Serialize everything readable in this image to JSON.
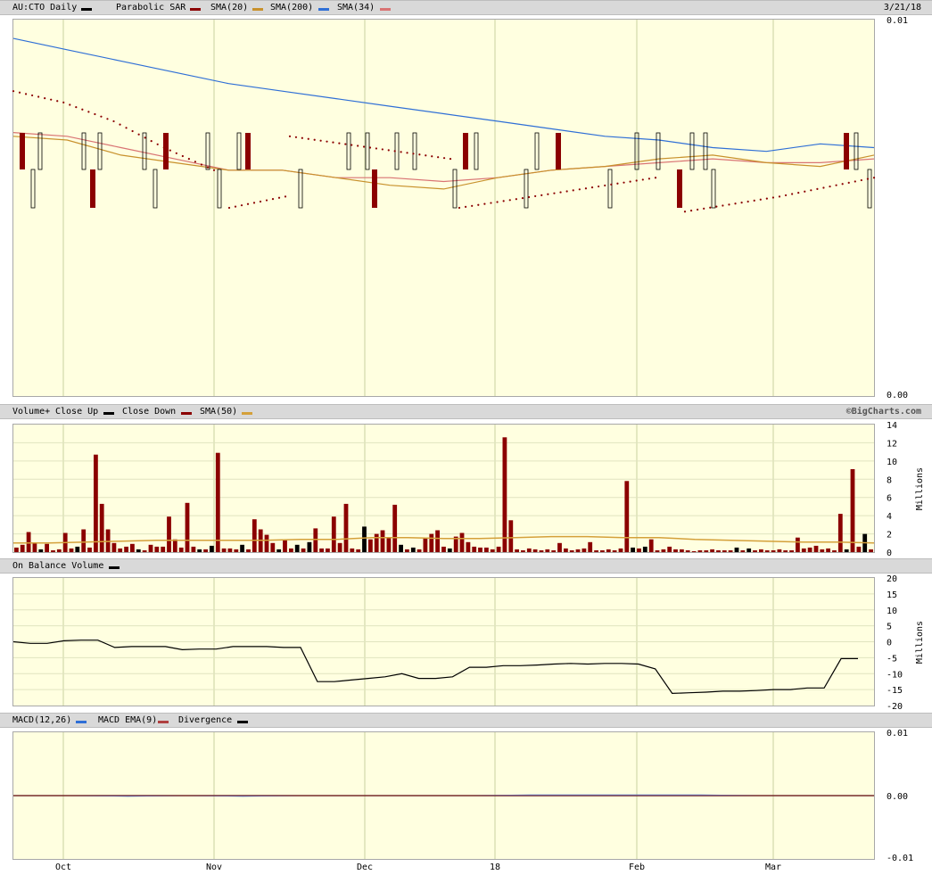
{
  "header": {
    "symbol_label": "AU:CTO Daily",
    "indicators": [
      {
        "label": "Parabolic SAR",
        "color": "#8b0000"
      },
      {
        "label": "SMA(20)",
        "color": "#c8912c"
      },
      {
        "label": "SMA(200)",
        "color": "#2f6fd6"
      },
      {
        "label": "SMA(34)",
        "color": "#d97373"
      }
    ],
    "symbol_color": "#000000",
    "date": "3/21/18"
  },
  "volume_header": {
    "label": "Volume+",
    "items": [
      {
        "label": "Close Up",
        "color": "#000000"
      },
      {
        "label": "Close Down",
        "color": "#8b0000"
      },
      {
        "label": "SMA(50)",
        "color": "#d4a03a"
      }
    ],
    "credit": "©BigCharts.com"
  },
  "obv_header": {
    "label": "On Balance Volume",
    "color": "#000000"
  },
  "macd_header": {
    "items": [
      {
        "label": "MACD(12,26)",
        "color": "#2f6fd6"
      },
      {
        "label": "MACD EMA(9)",
        "color": "#b04040"
      },
      {
        "label": "Divergence",
        "color": "#000000"
      }
    ]
  },
  "x_axis": {
    "labels": [
      "Oct",
      "Nov",
      "Dec",
      "18",
      "Feb",
      "Mar"
    ]
  },
  "chart_data": [
    {
      "type": "line",
      "title": "AU:CTO Daily",
      "ylim": [
        0.0,
        0.01
      ],
      "ytick_labels": [
        "0.01",
        "0.00"
      ],
      "grid": true,
      "series": [
        {
          "name": "SMA(200)",
          "values": [
            0.0095,
            0.0092,
            0.0089,
            0.0086,
            0.0083,
            0.0081,
            0.0079,
            0.0077,
            0.0075,
            0.0073,
            0.0071,
            0.0069,
            0.0068,
            0.0066,
            0.0065,
            0.0067,
            0.0066
          ]
        },
        {
          "name": "SMA(34)",
          "values": [
            0.007,
            0.0069,
            0.0066,
            0.0063,
            0.006,
            0.006,
            0.0058,
            0.0058,
            0.0057,
            0.0058,
            0.006,
            0.0061,
            0.0062,
            0.0063,
            0.0062,
            0.0062,
            0.0063
          ]
        },
        {
          "name": "SMA(20)",
          "values": [
            0.0069,
            0.0068,
            0.0064,
            0.0062,
            0.006,
            0.006,
            0.0058,
            0.0056,
            0.0055,
            0.0058,
            0.006,
            0.0061,
            0.0063,
            0.0064,
            0.0062,
            0.0061,
            0.0064
          ]
        }
      ],
      "sar_segments": [
        {
          "values": [
            0.0081,
            0.0078,
            0.0073,
            0.0066,
            0.006
          ]
        },
        {
          "values": [
            0.005,
            0.0053
          ]
        },
        {
          "values": [
            0.0069,
            0.0066,
            0.0063
          ]
        },
        {
          "values": [
            0.005,
            0.0054,
            0.0058
          ]
        },
        {
          "values": [
            0.0049,
            0.0053,
            0.0058
          ]
        }
      ]
    },
    {
      "type": "bar",
      "title": "Volume+",
      "ylabel": "Millions",
      "ylim": [
        0,
        14
      ],
      "ytick_labels": [
        "14",
        "12",
        "10",
        "8",
        "6",
        "4",
        "2",
        "0"
      ],
      "values": [
        0.5,
        0.8,
        2.2,
        1.0,
        0.3,
        0.9,
        0.2,
        0.3,
        2.1,
        0.4,
        0.6,
        2.5,
        0.5,
        10.7,
        5.3,
        2.5,
        1.0,
        0.4,
        0.6,
        0.9,
        0.3,
        0.2,
        0.8,
        0.6,
        0.6,
        3.9,
        1.4,
        0.5,
        5.4,
        0.6,
        0.3,
        0.3,
        0.7,
        10.9,
        0.4,
        0.4,
        0.3,
        0.8,
        0.3,
        3.6,
        2.5,
        1.9,
        1.0,
        0.3,
        1.3,
        0.4,
        0.8,
        0.4,
        1.1,
        2.6,
        0.4,
        0.4,
        3.9,
        1.0,
        5.3,
        0.4,
        0.3,
        2.8,
        1.4,
        2.0,
        2.4,
        1.6,
        5.2,
        0.8,
        0.3,
        0.5,
        0.3,
        1.6,
        2.0,
        2.4,
        0.6,
        0.4,
        1.7,
        2.1,
        1.1,
        0.6,
        0.5,
        0.5,
        0.3,
        0.6,
        12.6,
        3.5,
        0.3,
        0.2,
        0.4,
        0.3,
        0.2,
        0.3,
        0.2,
        1.0,
        0.4,
        0.2,
        0.3,
        0.4,
        1.1,
        0.2,
        0.2,
        0.3,
        0.2,
        0.4,
        7.8,
        0.5,
        0.4,
        0.6,
        1.4,
        0.2,
        0.3,
        0.6,
        0.3,
        0.3,
        0.2,
        0.1,
        0.2,
        0.2,
        0.3,
        0.2,
        0.2,
        0.2,
        0.5,
        0.2,
        0.4,
        0.2,
        0.3,
        0.2,
        0.2,
        0.3,
        0.2,
        0.2,
        1.6,
        0.4,
        0.5,
        0.7,
        0.3,
        0.4,
        0.2,
        4.2,
        0.3,
        9.1,
        0.6,
        2.0,
        0.3
      ],
      "close_up": [
        false,
        false,
        false,
        false,
        true,
        false,
        false,
        false,
        false,
        false,
        true,
        false,
        false,
        false,
        false,
        false,
        false,
        false,
        false,
        false,
        true,
        false,
        false,
        false,
        false,
        false,
        false,
        false,
        false,
        false,
        true,
        false,
        true,
        false,
        false,
        false,
        false,
        true,
        false,
        false,
        false,
        false,
        false,
        true,
        false,
        false,
        true,
        false,
        true,
        false,
        false,
        false,
        false,
        false,
        false,
        false,
        false,
        true,
        false,
        false,
        false,
        false,
        false,
        true,
        false,
        true,
        false,
        false,
        false,
        false,
        false,
        true,
        false,
        false,
        false,
        false,
        false,
        false,
        false,
        false,
        false,
        false,
        false,
        false,
        false,
        false,
        false,
        false,
        false,
        false,
        false,
        false,
        false,
        false,
        false,
        false,
        false,
        false,
        false,
        false,
        false,
        true,
        false,
        true,
        false,
        false,
        false,
        false,
        false,
        false,
        false,
        false,
        false,
        false,
        false,
        false,
        false,
        false,
        true,
        false,
        true,
        false,
        false,
        false,
        false,
        false,
        false,
        false,
        false,
        false,
        false,
        false,
        false,
        false,
        false,
        false,
        true,
        false,
        false,
        true
      ],
      "series_sma50": [
        1.0,
        1.0,
        1.1,
        1.2,
        1.3,
        1.3,
        1.3,
        1.3,
        1.4,
        1.4,
        1.6,
        1.6,
        1.5,
        1.5,
        1.6,
        1.7,
        1.7,
        1.6,
        1.6,
        1.4,
        1.3,
        1.2,
        1.1,
        1.1,
        1.0
      ]
    },
    {
      "type": "line",
      "title": "On Balance Volume",
      "ylabel": "Millions",
      "ylim": [
        -20,
        20
      ],
      "ytick_labels": [
        "20",
        "15",
        "10",
        "5",
        "0",
        "-5",
        "-10",
        "-15",
        "-20"
      ],
      "values": [
        0.0,
        -0.5,
        -0.5,
        0.3,
        0.5,
        0.5,
        -1.8,
        -1.5,
        -1.5,
        -1.5,
        -2.5,
        -2.3,
        -2.3,
        -1.5,
        -1.5,
        -1.5,
        -1.8,
        -1.8,
        -12.5,
        -12.5,
        -12.0,
        -11.5,
        -11.0,
        -10.0,
        -11.5,
        -11.5,
        -11.0,
        -8.0,
        -8.0,
        -7.5,
        -7.5,
        -7.3,
        -7.0,
        -6.8,
        -7.0,
        -6.8,
        -6.8,
        -7.0,
        -8.5,
        -16.2,
        -16.0,
        -15.8,
        -15.5,
        -15.5,
        -15.3,
        -15.0,
        -15.0,
        -14.5,
        -14.5,
        -5.3,
        -5.3
      ]
    },
    {
      "type": "line",
      "title": "MACD(12,26)",
      "ylim": [
        -0.01,
        0.01
      ],
      "ytick_labels": [
        "0.01",
        "0.00",
        "-0.01"
      ],
      "series": [
        {
          "name": "MACD(12,26)",
          "values": [
            0.0,
            0.0,
            -0.0001,
            0.0,
            -0.0001,
            0.0,
            0.0,
            0.0,
            0.0,
            0.0001,
            0.0001,
            0.0001,
            0.0001,
            0.0,
            0.0,
            0.0
          ]
        },
        {
          "name": "MACD EMA(9)",
          "values": [
            0.0,
            0.0,
            0.0,
            0.0,
            0.0,
            0.0,
            0.0,
            0.0,
            0.0,
            0.0,
            0.0,
            0.0,
            0.0,
            0.0,
            0.0,
            0.0
          ]
        }
      ]
    }
  ]
}
